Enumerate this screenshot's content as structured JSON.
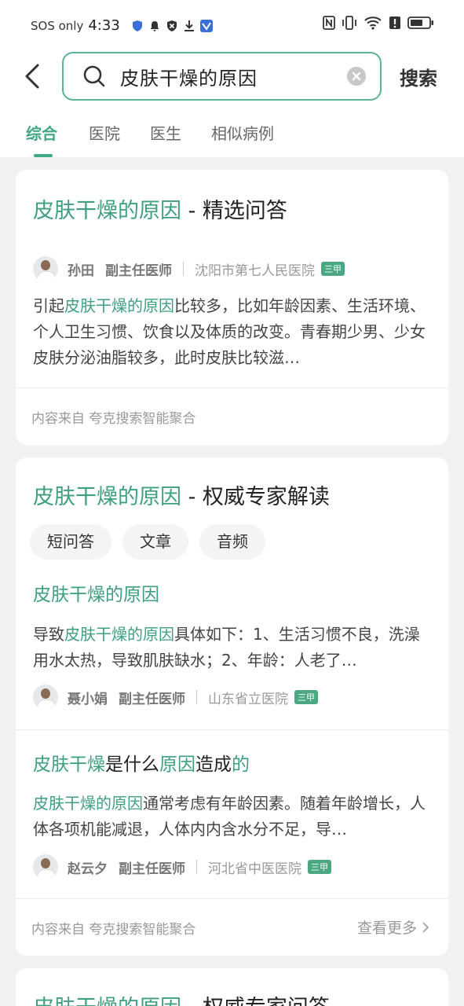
{
  "status_bar": {
    "carrier": "SOS only",
    "time": "4:33"
  },
  "search": {
    "query": "皮肤干燥的原因",
    "button": "搜索"
  },
  "tabs": [
    "综合",
    "医院",
    "医生",
    "相似病例"
  ],
  "cards": [
    {
      "title_hl": "皮肤干燥的原因",
      "title_rest": " - 精选问答",
      "doctor": {
        "name": "孙田",
        "title": "副主任医师",
        "hospital": "沈阳市第七人民医院",
        "badge": "三甲"
      },
      "text_pre": "引起",
      "text_hl": "皮肤干燥的原因",
      "text_post": "比较多，比如年龄因素、生活环境、个人卫生习惯、饮食以及体质的改变。青春期少男、少女皮肤分泌油脂较多，此时皮肤比较滋…",
      "source": "内容来自 夸克搜索智能聚合"
    },
    {
      "title_hl": "皮肤干燥的原因",
      "title_rest": " - 权威专家解读",
      "chips": [
        "短问答",
        "文章",
        "音频"
      ],
      "items": [
        {
          "title_parts": [
            {
              "t": "皮肤干燥的原因",
              "hl": true
            }
          ],
          "text_pre": "导致",
          "text_hl": "皮肤干燥的原因",
          "text_post": "具体如下：1、生活习惯不良，洗澡用水太热，导致肌肤缺水；2、年龄：人老了…",
          "doctor": {
            "name": "聂小娟",
            "title": "副主任医师",
            "hospital": "山东省立医院",
            "badge": "三甲"
          }
        },
        {
          "title_parts": [
            {
              "t": "皮肤干燥",
              "hl": true
            },
            {
              "t": "是什么",
              "hl": false
            },
            {
              "t": "原因",
              "hl": true
            },
            {
              "t": "造成",
              "hl": false
            },
            {
              "t": "的",
              "hl": true
            }
          ],
          "text_pre": "",
          "text_hl": "皮肤干燥的原因",
          "text_post": "通常考虑有年龄因素。随着年龄增长，人体各项机能减退，人体内内含水分不足，导…",
          "doctor": {
            "name": "赵云夕",
            "title": "副主任医师",
            "hospital": "河北省中医医院",
            "badge": "三甲"
          }
        }
      ],
      "source": "内容来自 夸克搜索智能聚合",
      "more": "查看更多"
    },
    {
      "title_hl": "皮肤干燥的原因",
      "title_rest": " - 权威专家问答"
    }
  ]
}
